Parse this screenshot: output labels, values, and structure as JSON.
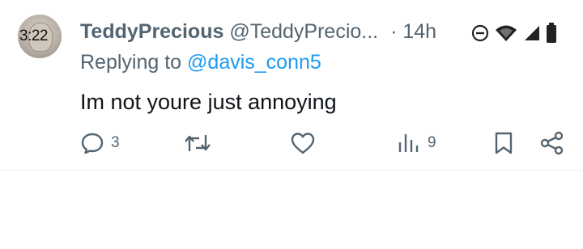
{
  "status_bar": {
    "time": "3:22",
    "icons": [
      "do-not-disturb-icon",
      "wifi-icon",
      "cell-signal-icon",
      "battery-icon"
    ]
  },
  "tweet": {
    "display_name": "TeddyPrecious",
    "handle": "@TeddyPrecio...",
    "separator": "·",
    "time": "14h",
    "replying_prefix": "Replying to",
    "replying_to": "@davis_conn5",
    "text": "Im not youre just annoying",
    "actions": {
      "reply_count": "3",
      "views_count": "9"
    }
  },
  "colors": {
    "accent": "#1d9bf0",
    "secondary_text": "#536471",
    "primary_text": "#0f1419"
  }
}
